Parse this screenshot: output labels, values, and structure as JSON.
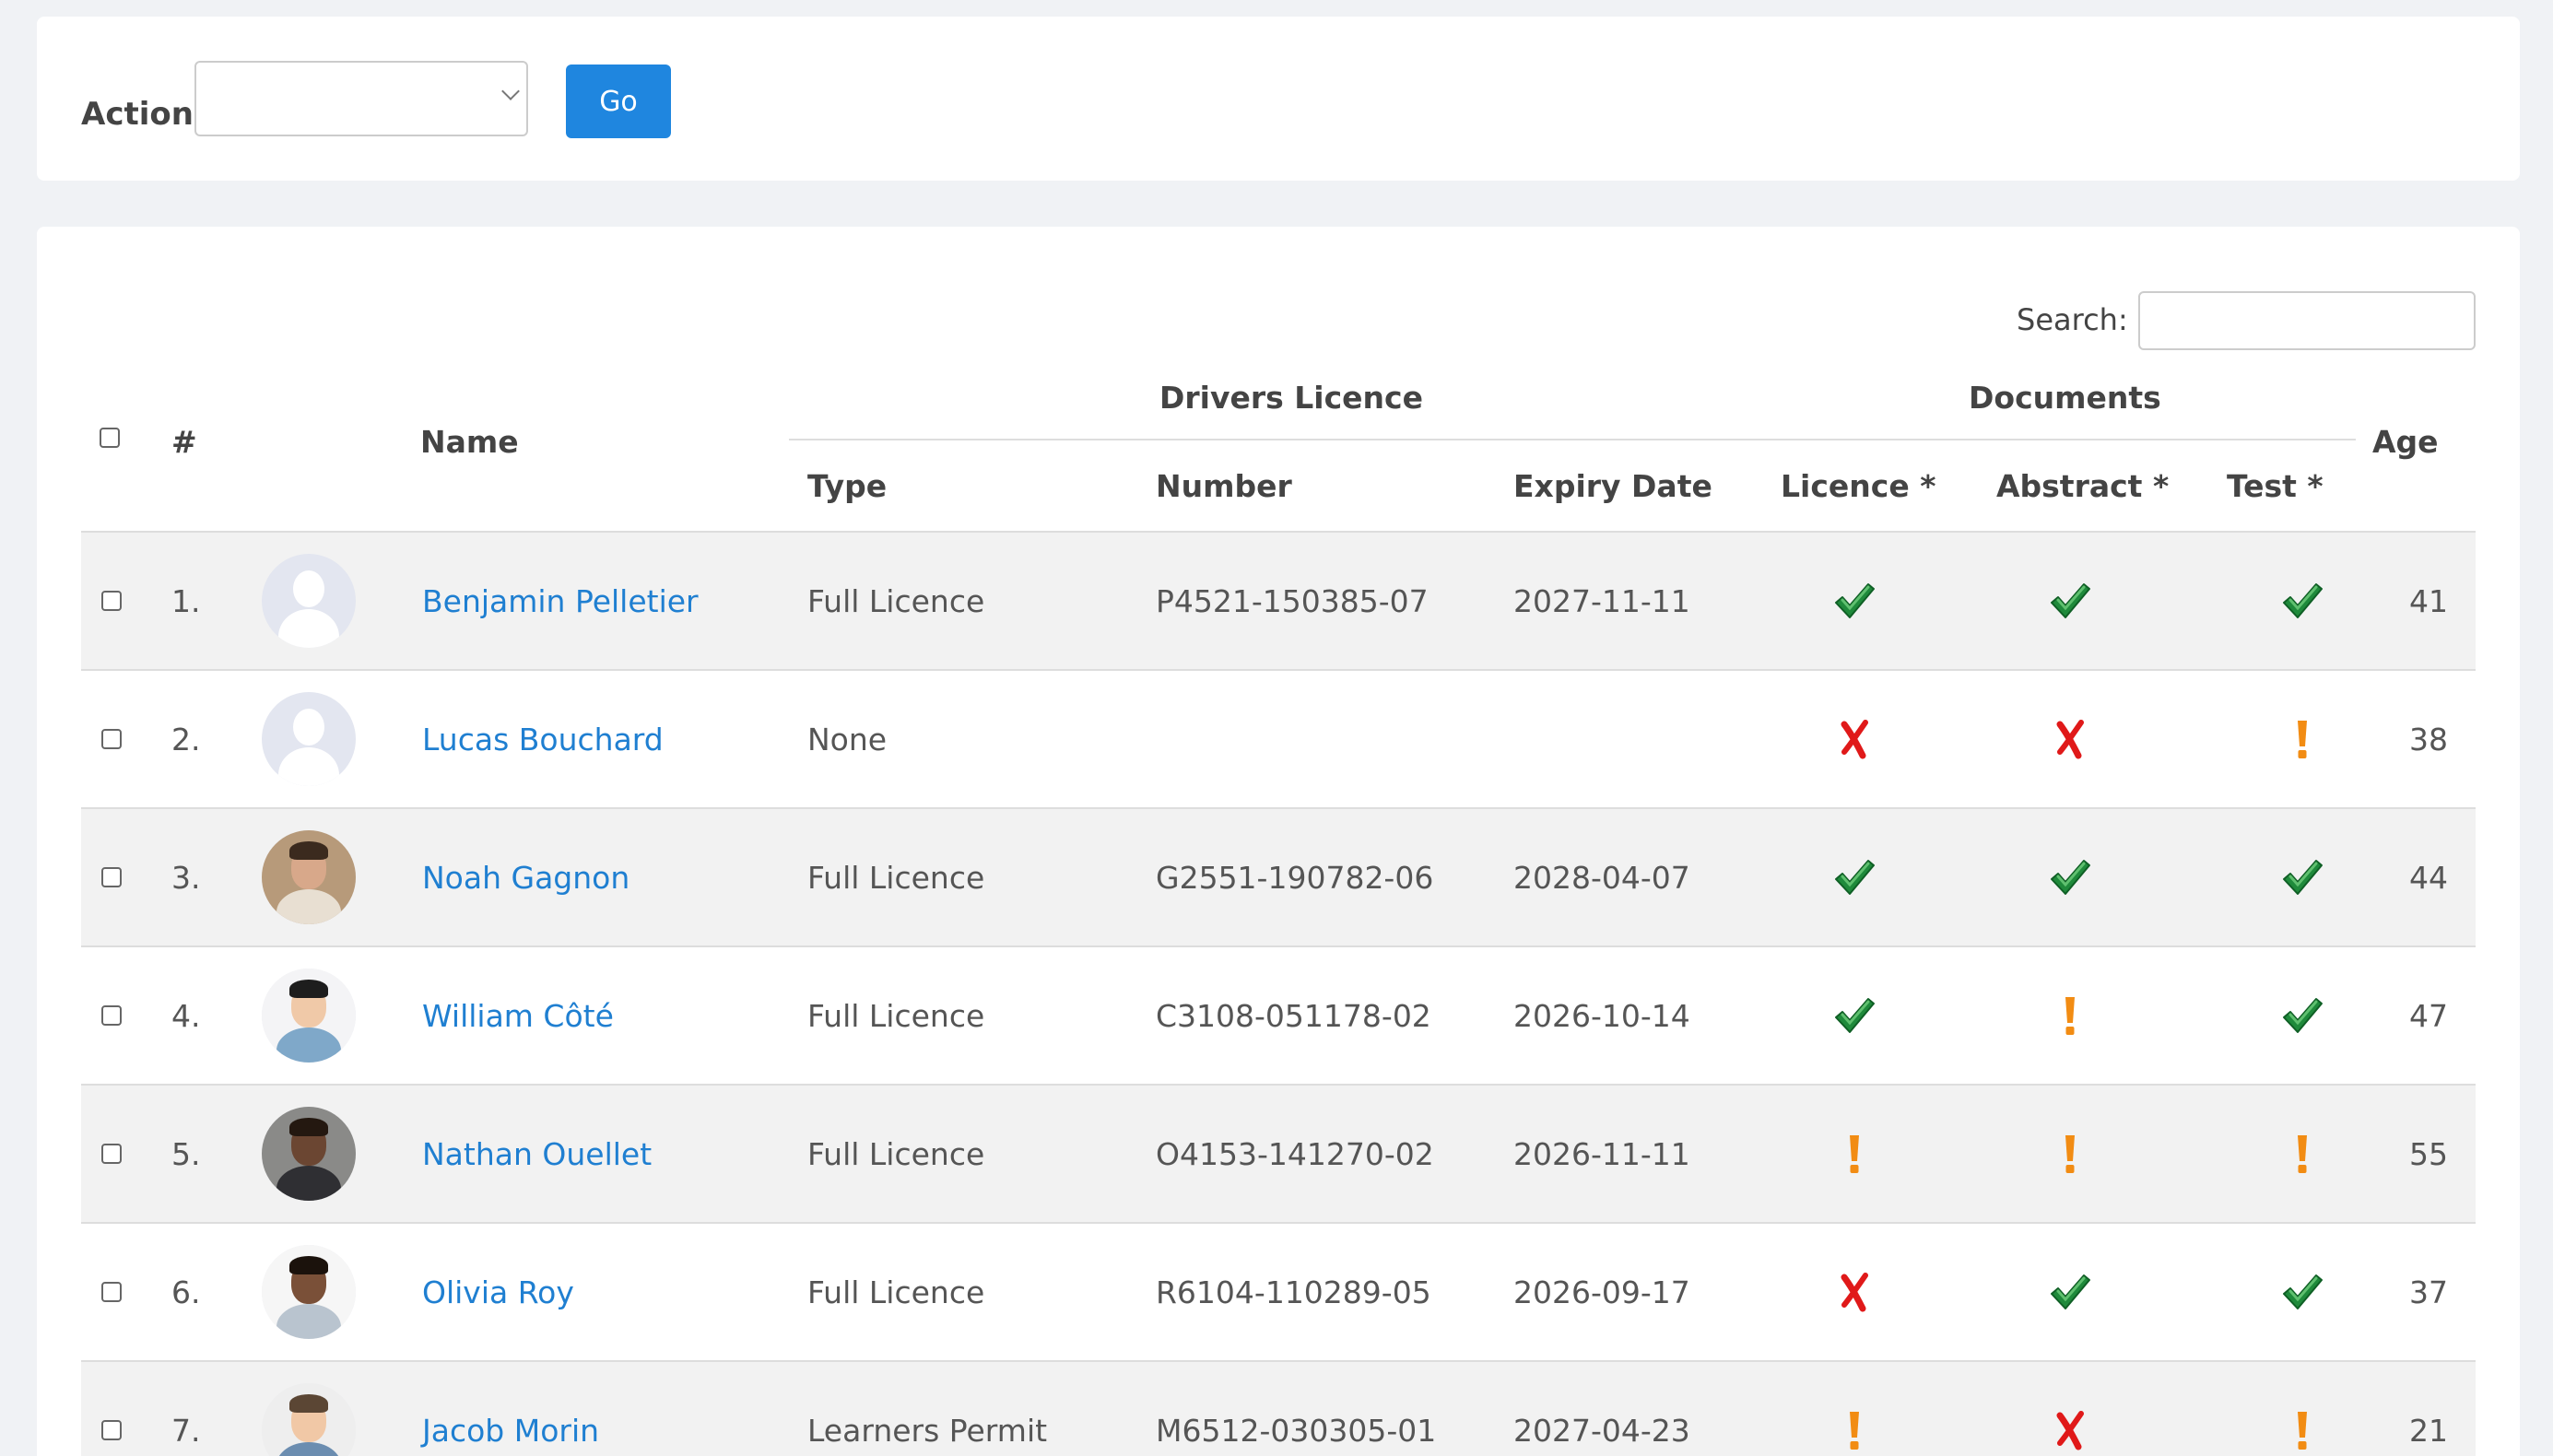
{
  "toolbar": {
    "action_label": "Action",
    "action_colon": ":",
    "action_selected": "",
    "go_label": "Go"
  },
  "search": {
    "label": "Search:",
    "value": ""
  },
  "table": {
    "headers": {
      "number": "#",
      "name": "Name",
      "drivers_licence_group": "Drivers Licence",
      "documents_group": "Documents",
      "type": "Type",
      "licence_number": "Number",
      "expiry_date": "Expiry Date",
      "doc_licence": "Licence *",
      "doc_abstract": "Abstract *",
      "doc_test": "Test *",
      "age": "Age"
    },
    "rows": [
      {
        "num": "1.",
        "name": "Benjamin Pelletier",
        "avatar": "placeholder-avatar",
        "type": "Full Licence",
        "number": "P4521-150385-07",
        "expiry": "2027-11-11",
        "licence": "check",
        "abstract": "check",
        "test": "check",
        "age": "41"
      },
      {
        "num": "2.",
        "name": "Lucas Bouchard",
        "avatar": "placeholder-avatar",
        "type": "None",
        "number": "",
        "expiry": "",
        "licence": "cross",
        "abstract": "cross",
        "test": "warning",
        "age": "38"
      },
      {
        "num": "3.",
        "name": "Noah Gagnon",
        "avatar": "photo-avatar",
        "type": "Full Licence",
        "number": "G2551-190782-06",
        "expiry": "2028-04-07",
        "licence": "check",
        "abstract": "check",
        "test": "check",
        "age": "44"
      },
      {
        "num": "4.",
        "name": "William Côté",
        "avatar": "photo-avatar",
        "type": "Full Licence",
        "number": "C3108-051178-02",
        "expiry": "2026-10-14",
        "licence": "check",
        "abstract": "warning",
        "test": "check",
        "age": "47"
      },
      {
        "num": "5.",
        "name": "Nathan Ouellet",
        "avatar": "photo-avatar",
        "type": "Full Licence",
        "number": "O4153-141270-02",
        "expiry": "2026-11-11",
        "licence": "warning",
        "abstract": "warning",
        "test": "warning",
        "age": "55"
      },
      {
        "num": "6.",
        "name": "Olivia Roy",
        "avatar": "photo-avatar",
        "type": "Full Licence",
        "number": "R6104-110289-05",
        "expiry": "2026-09-17",
        "licence": "cross",
        "abstract": "check",
        "test": "check",
        "age": "37"
      },
      {
        "num": "7.",
        "name": "Jacob Morin",
        "avatar": "photo-avatar",
        "type": "Learners Permit",
        "number": "M6512-030305-01",
        "expiry": "2027-04-23",
        "licence": "warning",
        "abstract": "cross",
        "test": "warning",
        "age": "21"
      }
    ]
  },
  "colors": {
    "accent": "#1f86df",
    "link": "#1f7fd1",
    "check": "#1f8a3b",
    "cross": "#e01919",
    "warning": "#f28c13"
  }
}
